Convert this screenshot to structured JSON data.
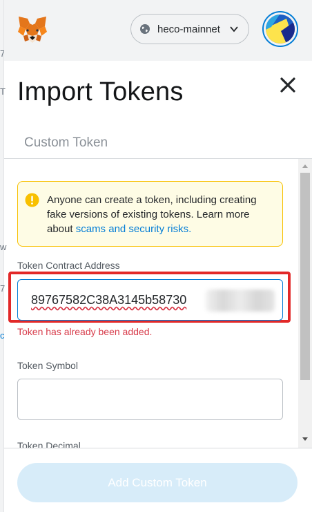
{
  "network": {
    "name": "heco-mainnet"
  },
  "page": {
    "title": "Import Tokens"
  },
  "tabs": [
    {
      "label": "Custom Token",
      "active": true
    }
  ],
  "warning": {
    "text": "Anyone can create a token, including creating fake versions of existing tokens. Learn more about ",
    "link_text": "scams and security risks",
    "suffix": "."
  },
  "form": {
    "address_label": "Token Contract Address",
    "address_value": "89767582C38A3145b58730",
    "address_error": "Token has already been added.",
    "symbol_label": "Token Symbol",
    "symbol_value": "",
    "decimal_label": "Token Decimal"
  },
  "footer": {
    "add_button_label": "Add Custom Token",
    "add_button_enabled": false
  },
  "colors": {
    "accent": "#037dd6",
    "error": "#d73a49",
    "warning_bg": "#fefce5",
    "warning_border": "#f8c000",
    "highlight": "#e22828",
    "disabled_button": "#d7ecf9"
  },
  "icons": {
    "logo": "metamask-fox-icon",
    "network": "globe-icon",
    "dropdown": "chevron-down-icon",
    "account": "account-identicon",
    "close": "close-icon",
    "warning": "warning-icon"
  }
}
